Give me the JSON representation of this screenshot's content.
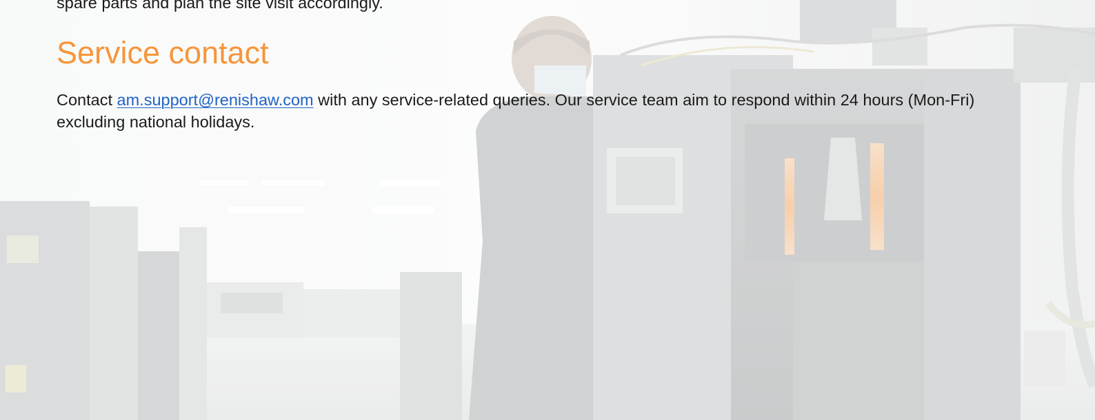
{
  "previous_paragraph": {
    "tail_text": "spare parts and plan the site visit accordingly."
  },
  "service_contact": {
    "heading": "Service contact",
    "text_before_link": "Contact ",
    "email_link": "am.support@renishaw.com",
    "text_after_link": " with any service-related queries. Our service team aim to respond within 24 hours (Mon-Fri) excluding national holidays."
  },
  "background": {
    "description_icon": "factory-photo",
    "tint": "#f4f5f5",
    "accent_orange": "#f7953a",
    "link_blue": "#1f63c6"
  }
}
